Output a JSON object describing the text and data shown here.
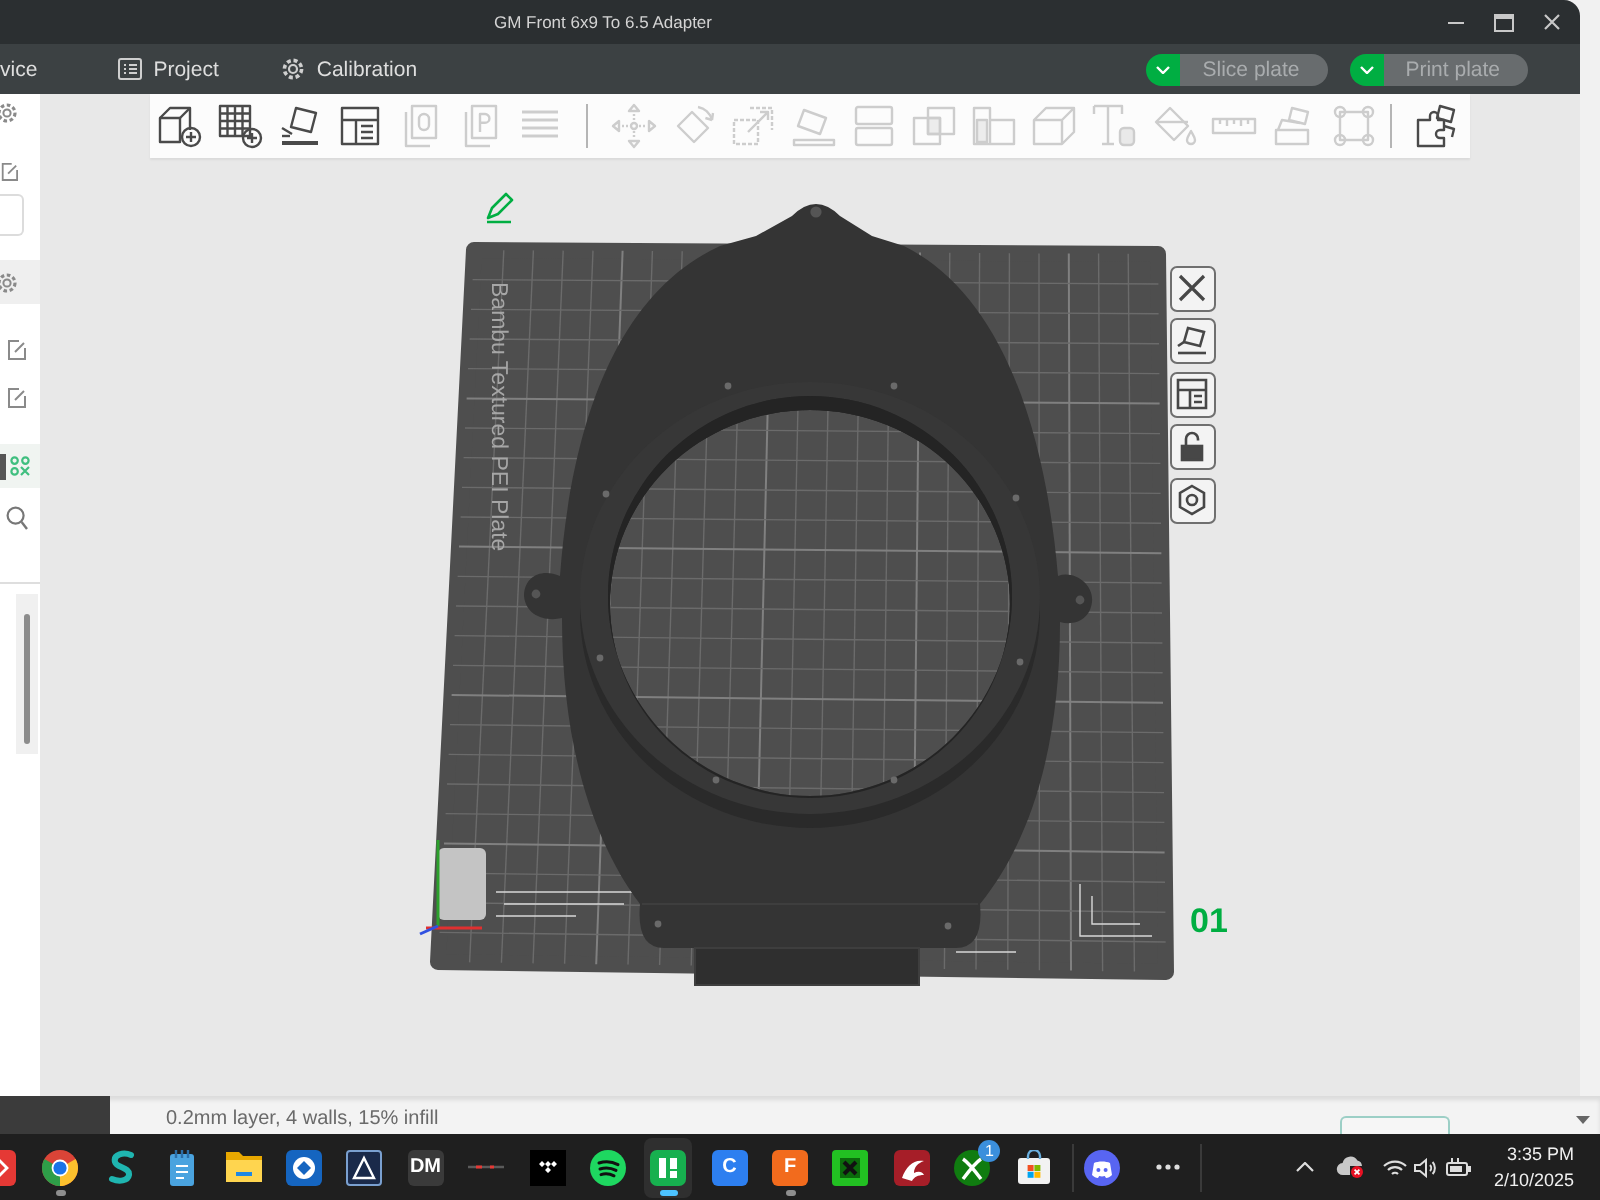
{
  "window": {
    "title": "GM Front 6x9 To 6.5 Adapter"
  },
  "menu_bar": {
    "tabs": [
      {
        "label": "vice"
      },
      {
        "label": "Project"
      },
      {
        "label": "Calibration"
      }
    ],
    "actions": [
      {
        "label": "Slice plate",
        "disabled": true
      },
      {
        "label": "Print plate",
        "disabled": true
      }
    ]
  },
  "toolbar": {
    "groups": [
      {
        "tools": [
          {
            "disabled": false
          },
          {
            "disabled": false
          },
          {
            "disabled": false
          },
          {
            "disabled": false
          },
          {
            "disabled": true
          },
          {
            "disabled": true
          },
          {
            "disabled": true
          }
        ]
      },
      {
        "tools": [
          {
            "disabled": true
          },
          {
            "disabled": true
          },
          {
            "disabled": true
          },
          {
            "disabled": true
          },
          {
            "disabled": true
          },
          {
            "disabled": true
          },
          {
            "disabled": true
          },
          {
            "disabled": true
          },
          {
            "disabled": true
          },
          {
            "disabled": true
          },
          {
            "disabled": true
          },
          {
            "disabled": true
          },
          {
            "disabled": true
          }
        ]
      },
      {
        "tools": [
          {
            "disabled": false
          }
        ]
      }
    ]
  },
  "plate": {
    "label": "Bambu Textured PEI Plate",
    "number": "01",
    "locked": false
  },
  "background_window": {
    "summary": "0.2mm layer, 4 walls, 15% infill"
  },
  "taskbar": {
    "groups": [
      {
        "apps": [
          {
            "selected": false,
            "running": false
          },
          {
            "selected": false,
            "running": true
          },
          {
            "selected": false,
            "running": false
          },
          {
            "selected": false,
            "running": false
          },
          {
            "selected": false,
            "running": false
          },
          {
            "selected": false,
            "running": false
          },
          {
            "selected": false,
            "running": false
          },
          {
            "label": "DM",
            "selected": false,
            "running": false
          },
          {
            "selected": false,
            "running": false
          },
          {
            "selected": false,
            "running": false
          },
          {
            "selected": false,
            "running": false
          },
          {
            "selected": true,
            "running": true
          },
          {
            "label": "C",
            "selected": false,
            "running": false
          },
          {
            "label": "F",
            "selected": false,
            "running": true
          },
          {
            "selected": false,
            "running": false
          },
          {
            "selected": false,
            "running": false
          },
          {
            "badge": "1",
            "selected": false,
            "running": false
          },
          {
            "selected": false,
            "running": false
          }
        ]
      },
      {
        "apps": [
          {
            "selected": false,
            "running": false
          }
        ]
      }
    ],
    "clock": {
      "time": "3:35 PM",
      "date": "2/10/2025"
    }
  }
}
